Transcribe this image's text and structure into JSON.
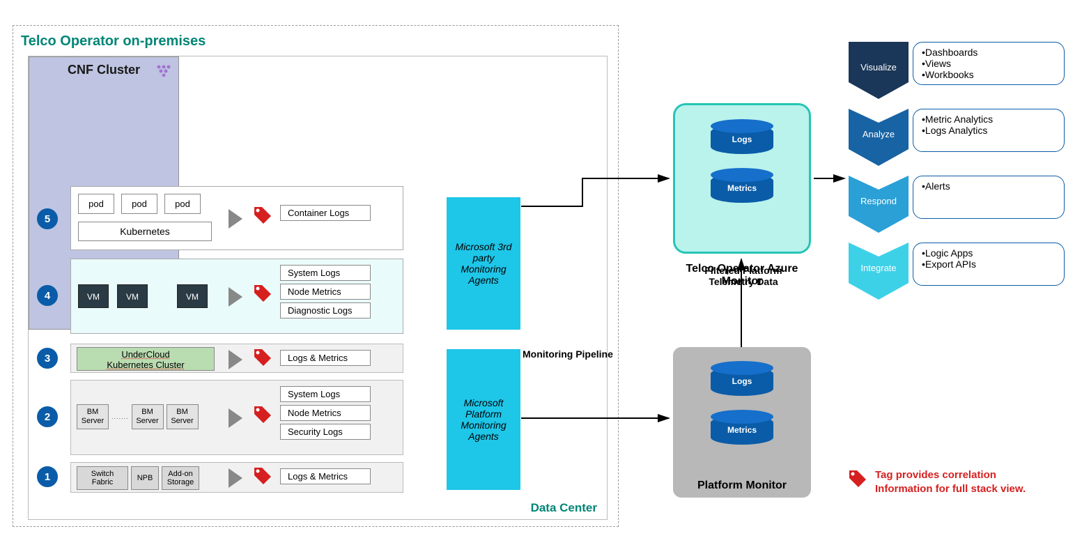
{
  "onprem_title": "Telco Operator on-premises",
  "datacenter_label": "Data Center",
  "cnf_cluster_title": "CNF Cluster",
  "layer5": {
    "num": "5",
    "pods": [
      "pod",
      "pod",
      "pod"
    ],
    "k8s": "Kubernetes",
    "logs": [
      "Container Logs"
    ]
  },
  "layer4": {
    "num": "4",
    "vms": [
      "VM",
      "VM",
      "VM"
    ],
    "logs": [
      "System Logs",
      "Node Metrics",
      "Diagnostic Logs"
    ]
  },
  "layer3": {
    "num": "3",
    "box_line1": "UnderCloud",
    "box_line2": "Kubernetes Cluster",
    "logs": [
      "Logs & Metrics"
    ]
  },
  "layer2": {
    "num": "2",
    "servers": [
      "BM Server",
      "BM Server",
      "BM Server"
    ],
    "dots": ".......",
    "logs": [
      "System Logs",
      "Node Metrics",
      "Security Logs"
    ]
  },
  "layer1": {
    "num": "1",
    "infra": [
      "Switch Fabric",
      "NPB",
      "Add-on Storage"
    ],
    "logs": [
      "Logs & Metrics"
    ]
  },
  "agent3p": "Microsoft 3rd party Monitoring Agents",
  "agentpf": "Microsoft Platform Monitoring Agents",
  "pipeline_label": "Monitoring Pipeline",
  "filtered_label": "Filtered Platform Telemetry Data",
  "azure": {
    "title": "Telco Operator Azure Monitor",
    "cyl1": "Logs",
    "cyl2": "Metrics"
  },
  "platform": {
    "title": "Platform Monitor",
    "cyl1": "Logs",
    "cyl2": "Metrics"
  },
  "chevrons": [
    {
      "label": "Visualize",
      "color": "#1a3658",
      "items": [
        "Dashboards",
        "Views",
        "Workbooks"
      ]
    },
    {
      "label": "Analyze",
      "color": "#1863a3",
      "items": [
        "Metric Analytics",
        "Logs Analytics"
      ]
    },
    {
      "label": "Respond",
      "color": "#2aa0d6",
      "items": [
        "Alerts"
      ]
    },
    {
      "label": "Integrate",
      "color": "#3dd1e8",
      "items": [
        "Logic Apps",
        "Export APIs"
      ]
    }
  ],
  "legend_text_l1": "Tag provides correlation",
  "legend_text_l2": "Information for full stack view."
}
